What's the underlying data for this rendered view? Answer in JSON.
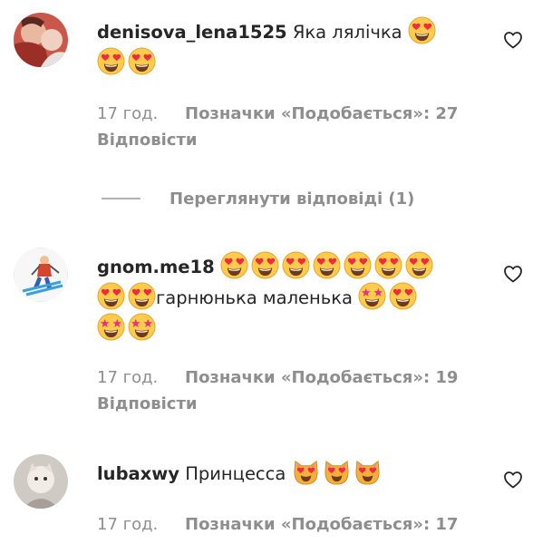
{
  "comments": [
    {
      "username": "denisova_lena1525",
      "text": "Яка лялічка",
      "time": "17 год.",
      "likes": "Позначки «Подобається»: 27",
      "reply": "Відповісти",
      "emojis_line1": [
        "heart-eyes-smiley"
      ],
      "emojis_line2": [
        "heart-eyes-smiley",
        "heart-eyes-smiley"
      ]
    },
    {
      "username": "gnom.me18",
      "text": "гарнюнька маленька",
      "time": "17 год.",
      "likes": "Позначки «Подобається»: 19",
      "reply": "Відповісти",
      "emojis_line1": [
        "heart-eyes-smiley",
        "heart-eyes-smiley",
        "heart-eyes-smiley",
        "heart-eyes-smiley",
        "heart-eyes-smiley",
        "heart-eyes-smiley",
        "heart-eyes-smiley"
      ],
      "emojis_line2_before": [
        "heart-eyes-smiley",
        "heart-eyes-smiley"
      ],
      "emojis_line2_after": [
        "star-struck",
        "heart-eyes-smiley"
      ],
      "emojis_line3": [
        "star-struck",
        "star-struck"
      ]
    },
    {
      "username": "lubaxwy",
      "text": "Принцесса",
      "time": "17 год.",
      "likes": "Позначки «Подобається»: 17",
      "emojis_line1": [
        "heart-eyes-cat",
        "heart-eyes-cat",
        "heart-eyes-cat"
      ]
    }
  ],
  "view_replies": "Переглянути відповіді (1)",
  "colors": {
    "text": "#262626",
    "secondary": "#8e8e8e",
    "emoji_face": "#ffcb4c",
    "heart": "#ef2b3f"
  }
}
